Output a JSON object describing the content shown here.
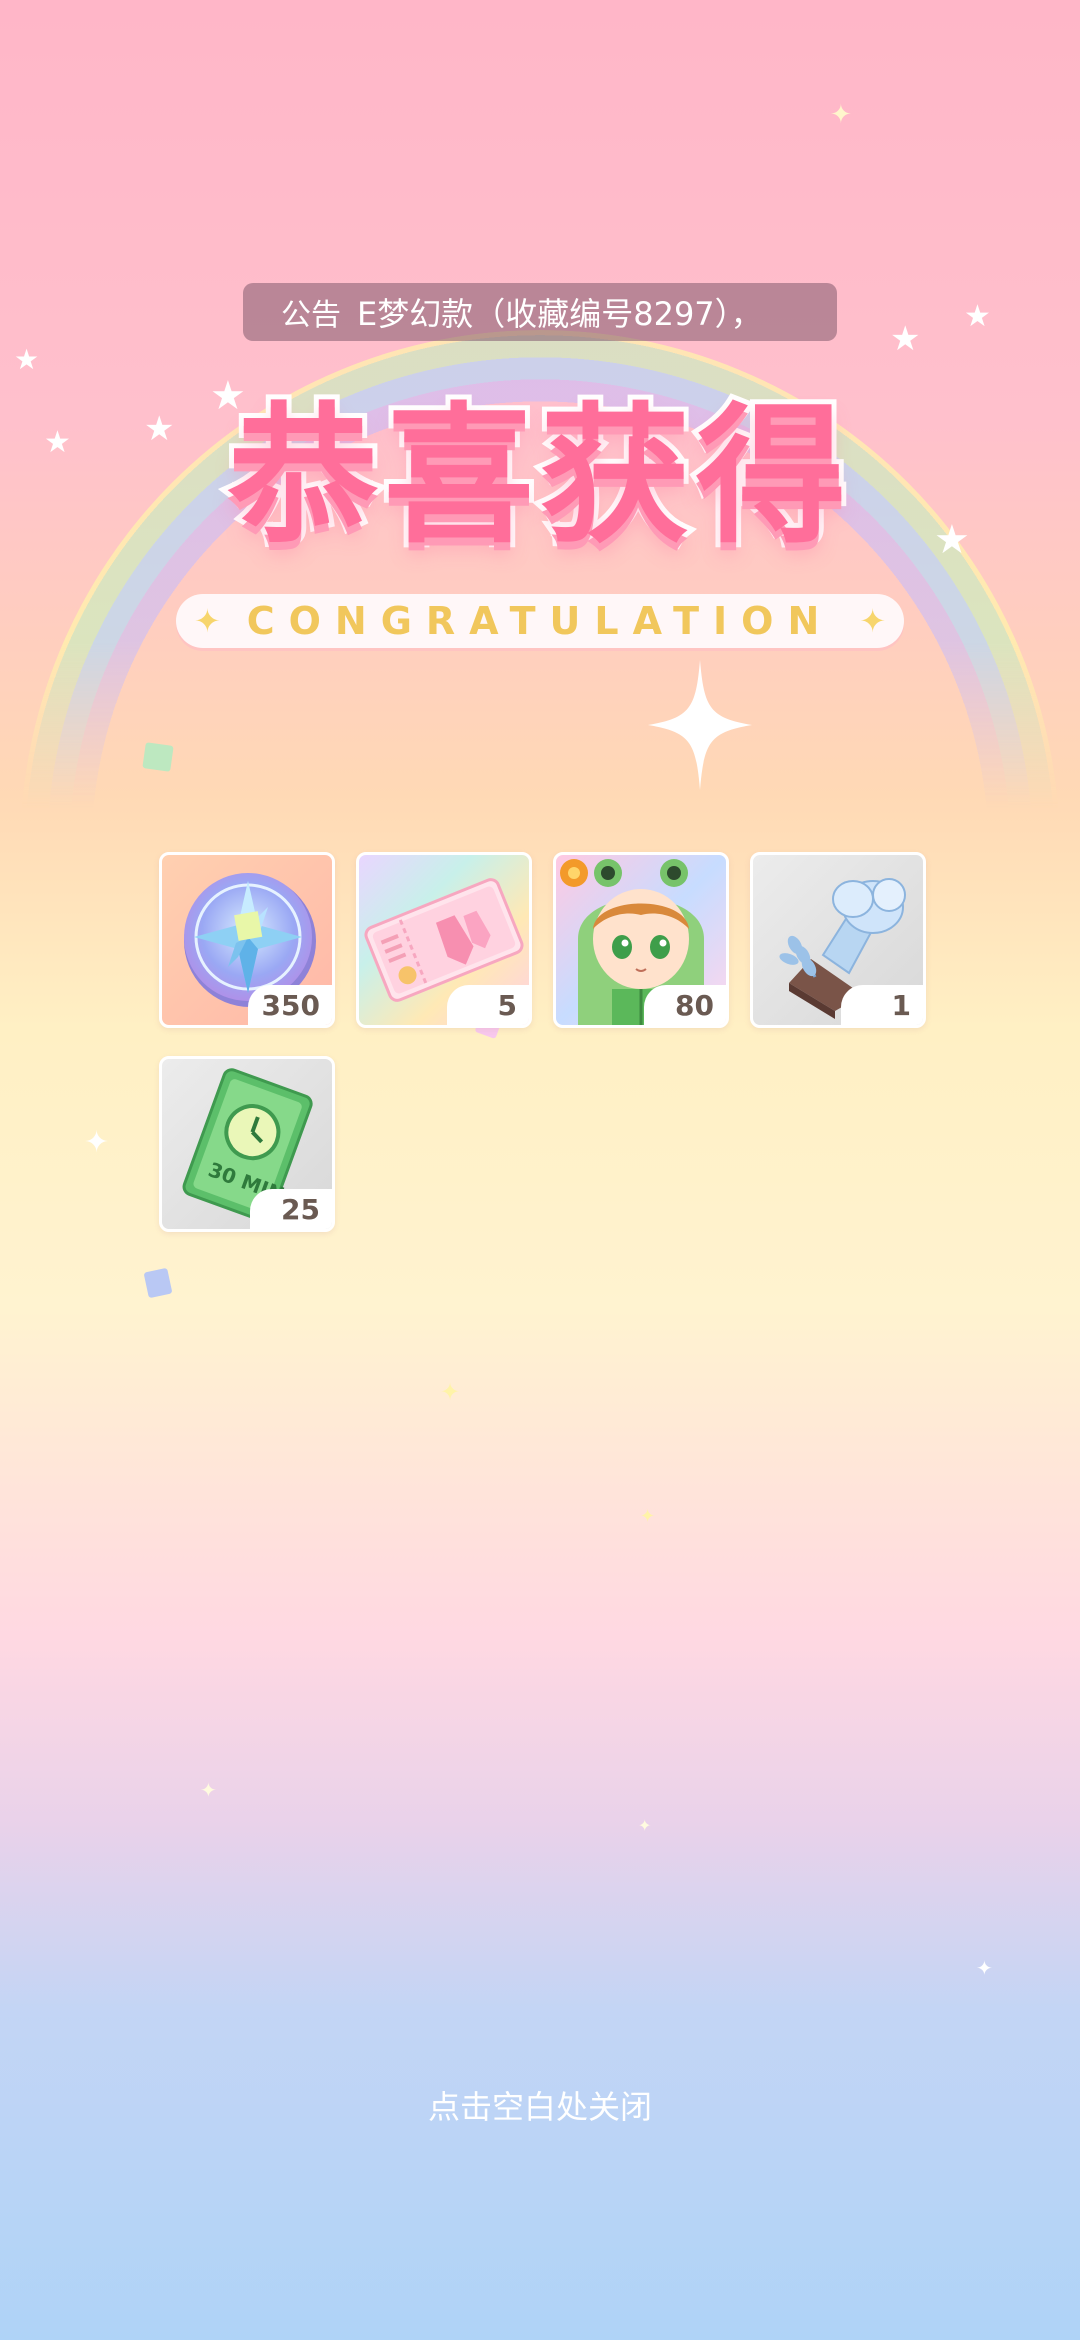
{
  "announcement": {
    "label": "公告",
    "text": "E梦幻款（收藏编号8297），"
  },
  "title": {
    "main": "恭喜获得",
    "subtitle": "CONGRATULATION"
  },
  "rewards": [
    {
      "icon": "compass-medal-icon",
      "count": "350"
    },
    {
      "icon": "ticket-icon",
      "count": "5"
    },
    {
      "icon": "frog-costume-character-icon",
      "count": "80"
    },
    {
      "icon": "chef-hat-trophy-icon",
      "count": "1"
    },
    {
      "icon": "30min-time-ticket-icon",
      "count": "25"
    }
  ],
  "ticket_text": "30 MIN",
  "close_hint": "点击空白处关闭",
  "colors": {
    "title_pink": "#ff6e9a",
    "subtitle_gold": "#f1c75c"
  }
}
